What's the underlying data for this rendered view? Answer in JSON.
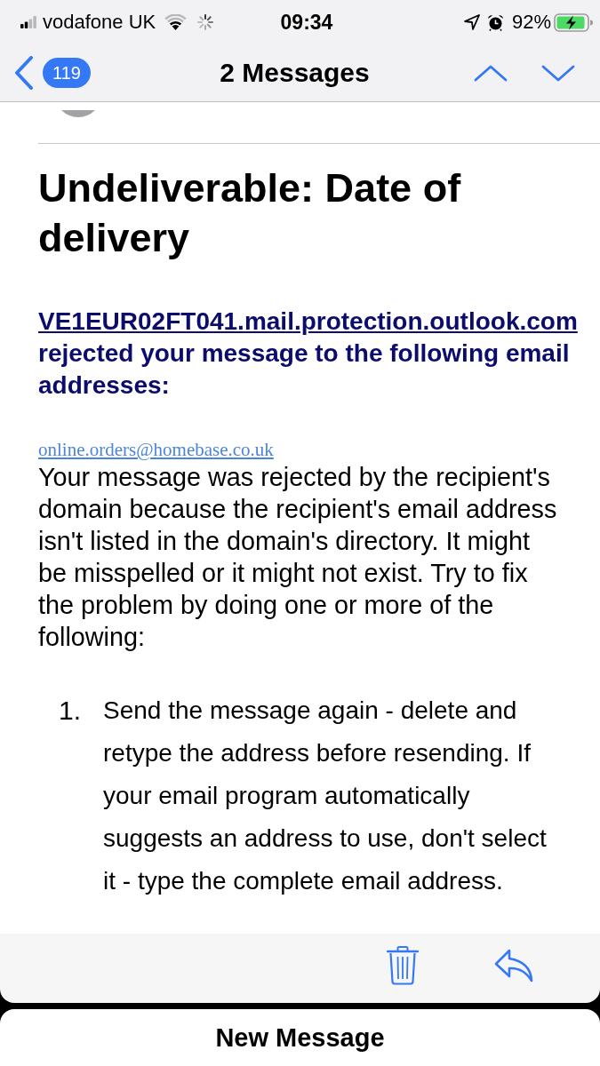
{
  "status_bar": {
    "carrier": "vodafone UK",
    "time": "09:34",
    "battery": "92%",
    "charging": true
  },
  "nav_bar": {
    "back_badge": "119",
    "title": "2 Messages"
  },
  "message": {
    "subject": "Undeliverable: Date of delivery",
    "notice": {
      "server_link": "VE1EUR02FT041.mail.protection.outlook.com",
      "text": "rejected your message to the following email addresses:"
    },
    "recipient_link": "online.orders@homebase.co.uk",
    "explanation": "Your message was rejected by the recipient's domain because the recipient's email address isn't listed in the domain's directory. It might be misspelled or it might not exist. Try to fix the problem by doing one or more of the following:",
    "steps": [
      {
        "number": "1.",
        "text": "Send the message again - delete and retype the address before resending. If your email program automatically suggests an address to use, don't select it - type the complete email address."
      }
    ]
  },
  "sheet": {
    "title": "New Message"
  }
}
